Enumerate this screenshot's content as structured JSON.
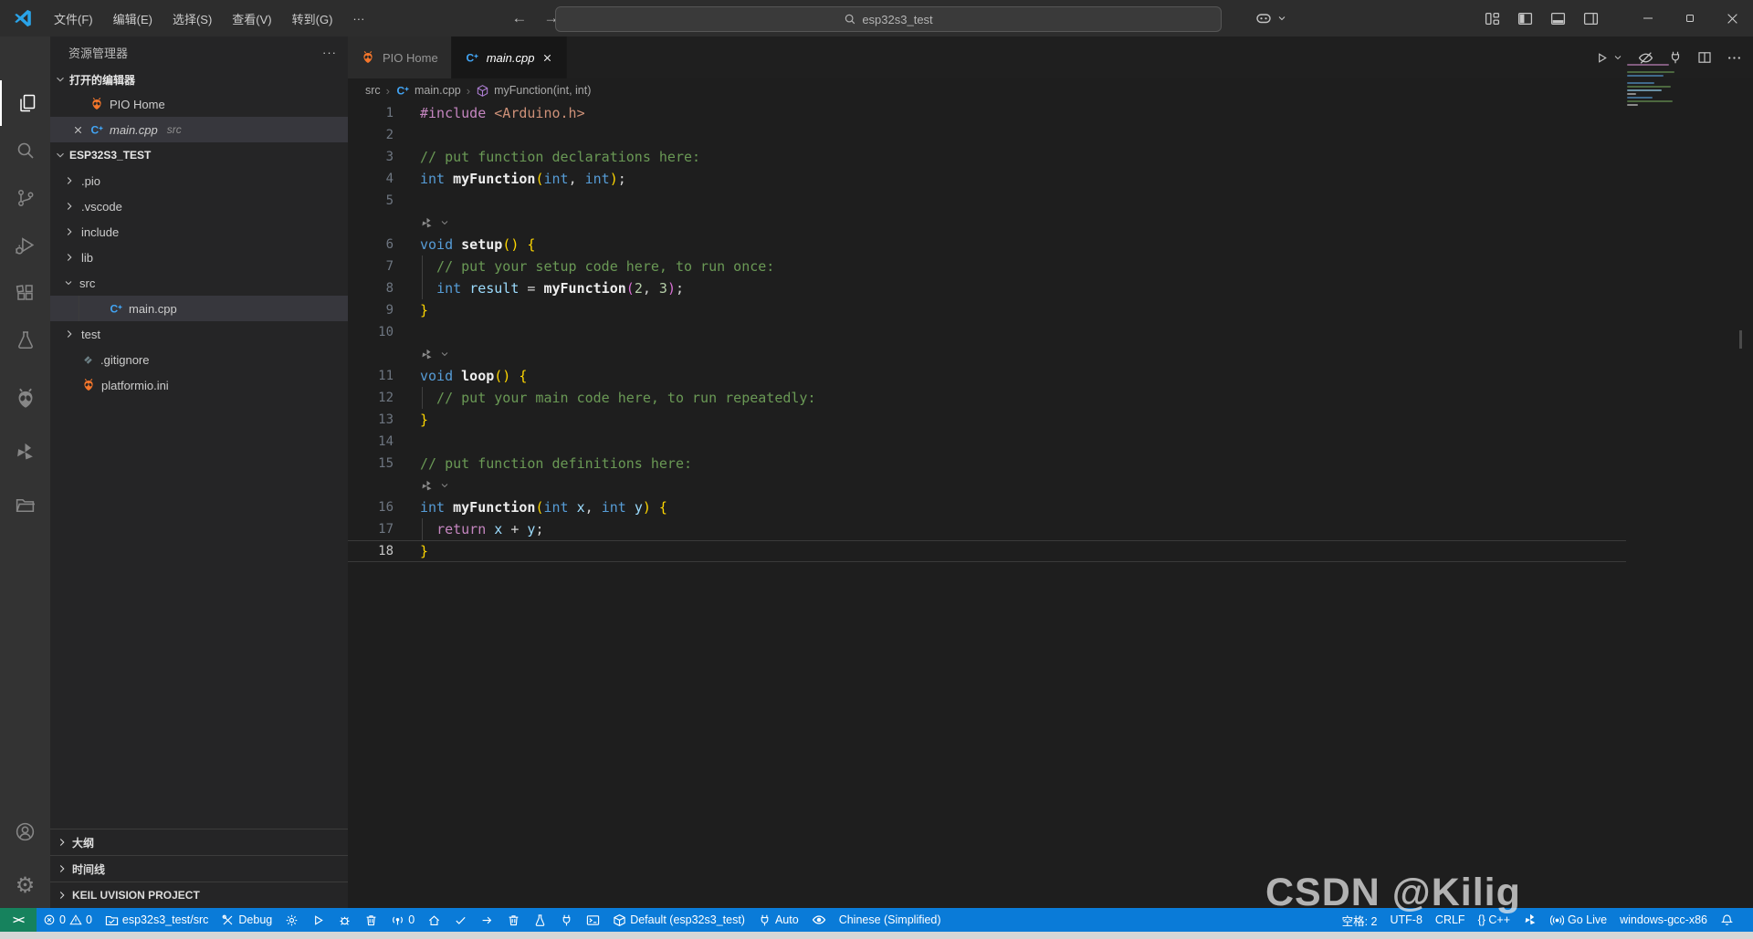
{
  "titlebar": {
    "menus": [
      "文件(F)",
      "编辑(E)",
      "选择(S)",
      "查看(V)",
      "转到(G)",
      "···"
    ],
    "search": "esp32s3_test",
    "nav": {
      "back": "←",
      "forward": "→"
    },
    "window_controls": [
      "minimize",
      "maximize",
      "close"
    ]
  },
  "tabs": [
    {
      "name": "tab-pio-home",
      "label": "PIO Home",
      "icon": "pio",
      "active": false,
      "italic": false,
      "close": false
    },
    {
      "name": "tab-main-cpp",
      "label": "main.cpp",
      "icon": "cpp",
      "active": true,
      "italic": true,
      "close": true
    }
  ],
  "breadcrumb": [
    {
      "label": "src",
      "icon": null
    },
    {
      "label": "main.cpp",
      "icon": "cpp"
    },
    {
      "label": "myFunction(int, int)",
      "icon": "cube"
    }
  ],
  "sidebar": {
    "title": "资源管理器",
    "open_editors_header": "打开的编辑器",
    "open_editors": [
      {
        "name": "open-editor-pio-home",
        "label": "PIO Home",
        "icon": "pio",
        "selected": false,
        "close": false,
        "italic": false,
        "detail": ""
      },
      {
        "name": "open-editor-main-cpp",
        "label": "main.cpp",
        "icon": "cpp",
        "selected": true,
        "close": true,
        "italic": true,
        "detail": "src"
      }
    ],
    "project_header": "ESP32S3_TEST",
    "tree": [
      {
        "name": "tree-item-pio",
        "label": ".pio",
        "chevron": "right",
        "icon": null,
        "indent": 0,
        "selected": false
      },
      {
        "name": "tree-item-vscode",
        "label": ".vscode",
        "chevron": "right",
        "icon": null,
        "indent": 0,
        "selected": false
      },
      {
        "name": "tree-item-include",
        "label": "include",
        "chevron": "right",
        "icon": null,
        "indent": 0,
        "selected": false
      },
      {
        "name": "tree-item-lib",
        "label": "lib",
        "chevron": "right",
        "icon": null,
        "indent": 0,
        "selected": false
      },
      {
        "name": "tree-item-src",
        "label": "src",
        "chevron": "down",
        "icon": null,
        "indent": 0,
        "selected": false
      },
      {
        "name": "tree-item-main-cpp",
        "label": "main.cpp",
        "chevron": "none",
        "icon": "cpp",
        "indent": 1,
        "selected": true
      },
      {
        "name": "tree-item-test",
        "label": "test",
        "chevron": "right",
        "icon": null,
        "indent": 0,
        "selected": false
      },
      {
        "name": "tree-item-gitignore",
        "label": ".gitignore",
        "chevron": "none",
        "icon": "git",
        "indent": 0,
        "selected": false
      },
      {
        "name": "tree-item-platformio-ini",
        "label": "platformio.ini",
        "chevron": "none",
        "icon": "pio",
        "indent": 0,
        "selected": false
      }
    ],
    "bottom_sections": [
      "大纲",
      "时间线",
      "KEIL UVISION PROJECT"
    ]
  },
  "activity_bar": {
    "top": [
      {
        "name": "explorer",
        "icon": "files",
        "active": true
      },
      {
        "name": "search",
        "icon": "search",
        "active": false
      },
      {
        "name": "source-control",
        "icon": "scm",
        "active": false
      },
      {
        "name": "run-debug",
        "icon": "debug",
        "active": false
      },
      {
        "name": "extensions",
        "icon": "ext",
        "active": false
      },
      {
        "name": "test",
        "icon": "beaker",
        "active": false
      },
      {
        "name": "platformio",
        "icon": "alienGray",
        "active": false
      },
      {
        "name": "codegeex",
        "icon": "leaf",
        "active": false
      },
      {
        "name": "project-manager",
        "icon": "folderOpen",
        "active": false
      }
    ],
    "bottom": [
      {
        "name": "accounts",
        "icon": "account"
      },
      {
        "name": "settings",
        "icon": "gearGlyph"
      }
    ]
  },
  "editor_actions": [
    {
      "name": "run-file",
      "icon": "play"
    },
    {
      "name": "run-dropdown",
      "icon": "chevD"
    },
    {
      "name": "toggle-hide",
      "icon": "hideEye"
    },
    {
      "name": "serial-monitor",
      "icon": "plug"
    },
    {
      "name": "split-editor",
      "icon": "split"
    },
    {
      "name": "more-actions",
      "icon": "ellipsis"
    }
  ],
  "code": {
    "language": "cpp",
    "file": "main.cpp",
    "lines": [
      {
        "n": "1",
        "segs": [
          [
            "ctl",
            "#include"
          ],
          [
            "pln",
            " "
          ],
          [
            "str",
            "<Arduino.h>"
          ]
        ]
      },
      {
        "n": "2",
        "segs": []
      },
      {
        "n": "3",
        "segs": [
          [
            "com",
            "// put function declarations here:"
          ]
        ]
      },
      {
        "n": "4",
        "segs": [
          [
            "kw",
            "int"
          ],
          [
            "pln",
            " "
          ],
          [
            "fn",
            "myFunction"
          ],
          [
            "b1",
            "("
          ],
          [
            "kw",
            "int"
          ],
          [
            "pln",
            ", "
          ],
          [
            "kw",
            "int"
          ],
          [
            "b1",
            ")"
          ],
          [
            "pln",
            ";"
          ]
        ]
      },
      {
        "n": "5",
        "segs": []
      },
      {
        "widget": true
      },
      {
        "n": "6",
        "segs": [
          [
            "kw",
            "void"
          ],
          [
            "pln",
            " "
          ],
          [
            "fn",
            "setup"
          ],
          [
            "b1",
            "()"
          ],
          [
            "pln",
            " "
          ],
          [
            "b1",
            "{"
          ]
        ]
      },
      {
        "n": "7",
        "guide": true,
        "segs": [
          [
            "com",
            "  // put your setup code here, to run once:"
          ]
        ]
      },
      {
        "n": "8",
        "guide": true,
        "segs": [
          [
            "pln",
            "  "
          ],
          [
            "kw",
            "int"
          ],
          [
            "pln",
            " "
          ],
          [
            "var",
            "result"
          ],
          [
            "pln",
            " = "
          ],
          [
            "fn",
            "myFunction"
          ],
          [
            "b2",
            "("
          ],
          [
            "num",
            "2"
          ],
          [
            "pln",
            ", "
          ],
          [
            "num",
            "3"
          ],
          [
            "b2",
            ")"
          ],
          [
            "pln",
            ";"
          ]
        ]
      },
      {
        "n": "9",
        "segs": [
          [
            "b1",
            "}"
          ]
        ]
      },
      {
        "n": "10",
        "segs": []
      },
      {
        "widget": true
      },
      {
        "n": "11",
        "segs": [
          [
            "kw",
            "void"
          ],
          [
            "pln",
            " "
          ],
          [
            "fn",
            "loop"
          ],
          [
            "b1",
            "()"
          ],
          [
            "pln",
            " "
          ],
          [
            "b1",
            "{"
          ]
        ]
      },
      {
        "n": "12",
        "guide": true,
        "segs": [
          [
            "com",
            "  // put your main code here, to run repeatedly:"
          ]
        ]
      },
      {
        "n": "13",
        "segs": [
          [
            "b1",
            "}"
          ]
        ]
      },
      {
        "n": "14",
        "segs": []
      },
      {
        "n": "15",
        "segs": [
          [
            "com",
            "// put function definitions here:"
          ]
        ]
      },
      {
        "widget": true
      },
      {
        "n": "16",
        "segs": [
          [
            "kw",
            "int"
          ],
          [
            "pln",
            " "
          ],
          [
            "fn",
            "myFunction"
          ],
          [
            "b1",
            "("
          ],
          [
            "kw",
            "int"
          ],
          [
            "pln",
            " "
          ],
          [
            "var",
            "x"
          ],
          [
            "pln",
            ", "
          ],
          [
            "kw",
            "int"
          ],
          [
            "pln",
            " "
          ],
          [
            "var",
            "y"
          ],
          [
            "b1",
            ")"
          ],
          [
            "pln",
            " "
          ],
          [
            "b1",
            "{"
          ]
        ]
      },
      {
        "n": "17",
        "guide": true,
        "segs": [
          [
            "pln",
            "  "
          ],
          [
            "ctl",
            "return"
          ],
          [
            "pln",
            " "
          ],
          [
            "var",
            "x"
          ],
          [
            "pln",
            " + "
          ],
          [
            "var",
            "y"
          ],
          [
            "pln",
            ";"
          ]
        ]
      },
      {
        "n": "18",
        "current": true,
        "segs": [
          [
            "b1",
            "}"
          ]
        ]
      }
    ]
  },
  "statusbar": {
    "remote_icon": "><",
    "left": [
      {
        "name": "problems",
        "parts": [
          [
            "errorC",
            "0"
          ],
          [
            "warn",
            "0"
          ]
        ]
      },
      {
        "name": "pio-project-folder",
        "parts": [
          [
            "folderCheck",
            "esp32s3_test/src"
          ]
        ]
      },
      {
        "name": "pio-debug",
        "parts": [
          [
            "tools",
            "Debug"
          ]
        ]
      },
      {
        "name": "config-gear",
        "parts": [
          [
            "gearS",
            ""
          ]
        ]
      },
      {
        "name": "run",
        "parts": [
          [
            "play",
            ""
          ]
        ]
      },
      {
        "name": "debug-bug",
        "parts": [
          [
            "bug",
            ""
          ]
        ]
      },
      {
        "name": "clean-1",
        "parts": [
          [
            "trash",
            ""
          ]
        ]
      },
      {
        "name": "serial-ports",
        "parts": [
          [
            "antenna",
            "0"
          ]
        ]
      },
      {
        "name": "pio-home",
        "parts": [
          [
            "home",
            ""
          ]
        ]
      },
      {
        "name": "pio-build",
        "parts": [
          [
            "check",
            ""
          ]
        ]
      },
      {
        "name": "pio-upload",
        "parts": [
          [
            "arrowR",
            ""
          ]
        ]
      },
      {
        "name": "pio-clean",
        "parts": [
          [
            "trash",
            ""
          ]
        ]
      },
      {
        "name": "pio-test",
        "parts": [
          [
            "beakerS",
            ""
          ]
        ]
      },
      {
        "name": "pio-serial-monitor",
        "parts": [
          [
            "plugS",
            ""
          ]
        ]
      },
      {
        "name": "pio-terminal",
        "parts": [
          [
            "term",
            ""
          ]
        ]
      },
      {
        "name": "pio-env",
        "parts": [
          [
            "box",
            "Default (esp32s3_test)"
          ]
        ]
      },
      {
        "name": "port-auto",
        "parts": [
          [
            "plugS",
            "Auto"
          ]
        ]
      },
      {
        "name": "toggle-preview",
        "parts": [
          [
            "eye",
            ""
          ]
        ]
      },
      {
        "name": "display-language",
        "parts": [
          [
            "none",
            "Chinese (Simplified)"
          ]
        ]
      }
    ],
    "right": [
      {
        "name": "indentation",
        "parts": [
          [
            "none",
            "空格: 2"
          ]
        ]
      },
      {
        "name": "encoding",
        "parts": [
          [
            "none",
            "UTF-8"
          ]
        ]
      },
      {
        "name": "eol",
        "parts": [
          [
            "none",
            "CRLF"
          ]
        ]
      },
      {
        "name": "language-mode",
        "parts": [
          [
            "none",
            "{} C++"
          ]
        ]
      },
      {
        "name": "codegeex-status",
        "parts": [
          [
            "leafS",
            ""
          ]
        ]
      },
      {
        "name": "go-live",
        "parts": [
          [
            "broadcast",
            "Go Live"
          ]
        ]
      },
      {
        "name": "compiler",
        "parts": [
          [
            "none",
            "windows-gcc-x86"
          ]
        ]
      },
      {
        "name": "notifications",
        "parts": [
          [
            "bell",
            ""
          ]
        ]
      }
    ]
  },
  "watermark": "CSDN @Kilig",
  "colors": {
    "statusbar_bg": "#0a7bd8",
    "remote_bg": "#16825d",
    "selection_bg": "#37373d",
    "pio_orange": "#f4762b",
    "cpp_blue": "#42a5f5",
    "symbol_purple": "#b180d7",
    "syntax": {
      "keyword": "#569cd6",
      "control": "#c586c0",
      "string": "#ce9178",
      "comment": "#6a9955",
      "function": "#eeeeee",
      "variable": "#9cdcfe",
      "number": "#b5cea8",
      "bracket1": "#ffd700",
      "bracket2": "#da70d6",
      "plain": "#d4d4d4"
    }
  }
}
